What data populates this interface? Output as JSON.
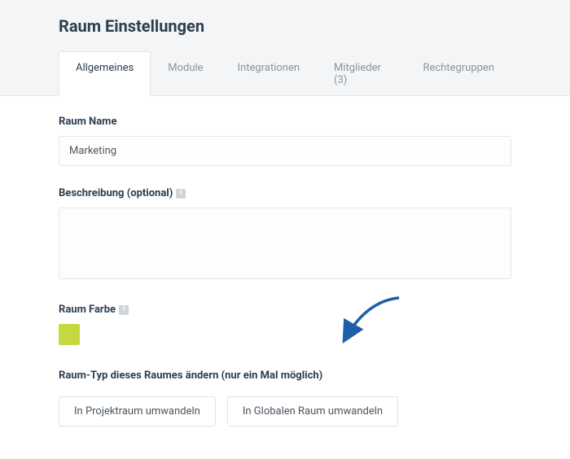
{
  "header": {
    "title": "Raum Einstellungen"
  },
  "tabs": {
    "items": [
      {
        "label": "Allgemeines",
        "active": true
      },
      {
        "label": "Module",
        "active": false
      },
      {
        "label": "Integrationen",
        "active": false
      },
      {
        "label": "Mitglieder (3)",
        "active": false
      },
      {
        "label": "Rechtegruppen",
        "active": false
      }
    ]
  },
  "form": {
    "room_name": {
      "label": "Raum Name",
      "value": "Marketing"
    },
    "description": {
      "label": "Beschreibung (optional)",
      "value": ""
    },
    "room_color": {
      "label": "Raum Farbe",
      "swatch_hex": "#c6d83f"
    },
    "room_type": {
      "label": "Raum-Typ dieses Raumes ändern (nur ein Mal möglich)",
      "convert_project_label": "In Projektraum umwandeln",
      "convert_global_label": "In Globalen Raum umwandeln"
    }
  },
  "annotation": {
    "arrow_color": "#1f5fa8"
  }
}
